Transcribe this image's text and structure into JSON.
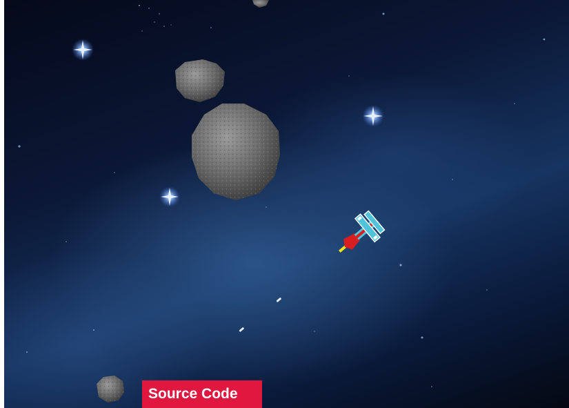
{
  "game": {
    "title": "",
    "scene": "space-shooter"
  },
  "caption": {
    "label": "Source Code",
    "color": "#e0173f"
  },
  "sprites": {
    "ship_icon": "spaceship-icon",
    "asteroid_icon": "asteroid-icon",
    "star_icon": "star-icon",
    "bullet_icon": "bullet-icon"
  },
  "colors": {
    "space_dark": "#05091a",
    "space_blue": "#163460",
    "asteroid": "#6b6b6b",
    "ship_cyan": "#4fc3d9",
    "ship_red": "#d81e1e",
    "ship_exhaust": "#f5e51a"
  }
}
